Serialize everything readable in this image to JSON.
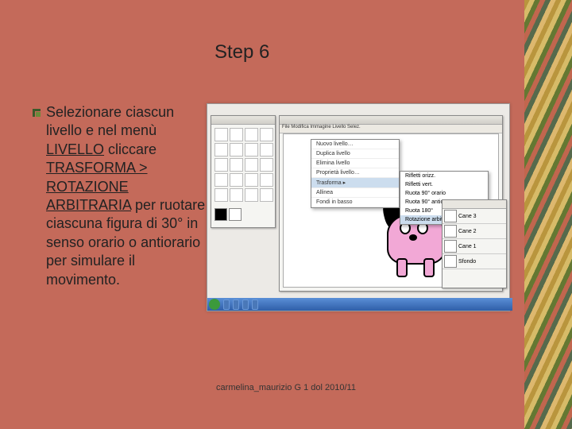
{
  "title": "Step 6",
  "body": {
    "t1": "Selezionare ciascun livello e nel menù ",
    "u1": "LIVELLO",
    "t2": " cliccare ",
    "u2": "TRASFORMA > ROTAZIONE ARBITRARIA",
    "t3": " per ruotare ciascuna figura di 30° in senso orario o antiorario per simulare il movimento."
  },
  "footer": "carmelina_maurizio G 1 dol 2010/11",
  "screenshot": {
    "menubar": "File  Modifica  Immagine  Livello  Selez.",
    "menu_items": [
      "Nuovo livello…",
      "Duplica livello",
      "Elimina livello",
      "Proprietà livello…",
      "Trasforma            ▸",
      "Allinea",
      "Fondi in basso"
    ],
    "submenu_items": [
      "Rifletti orizz.",
      "Rifletti vert.",
      "Ruota 90° orario",
      "Ruota 90° antior.",
      "Ruota 180°",
      "Rotazione arbitraria…"
    ],
    "layer_labels": [
      "Cane 3",
      "Cane 2",
      "Cane 1",
      "Sfondo"
    ],
    "swatches": {
      "fg": "#000000",
      "bg": "#ffffff"
    }
  }
}
